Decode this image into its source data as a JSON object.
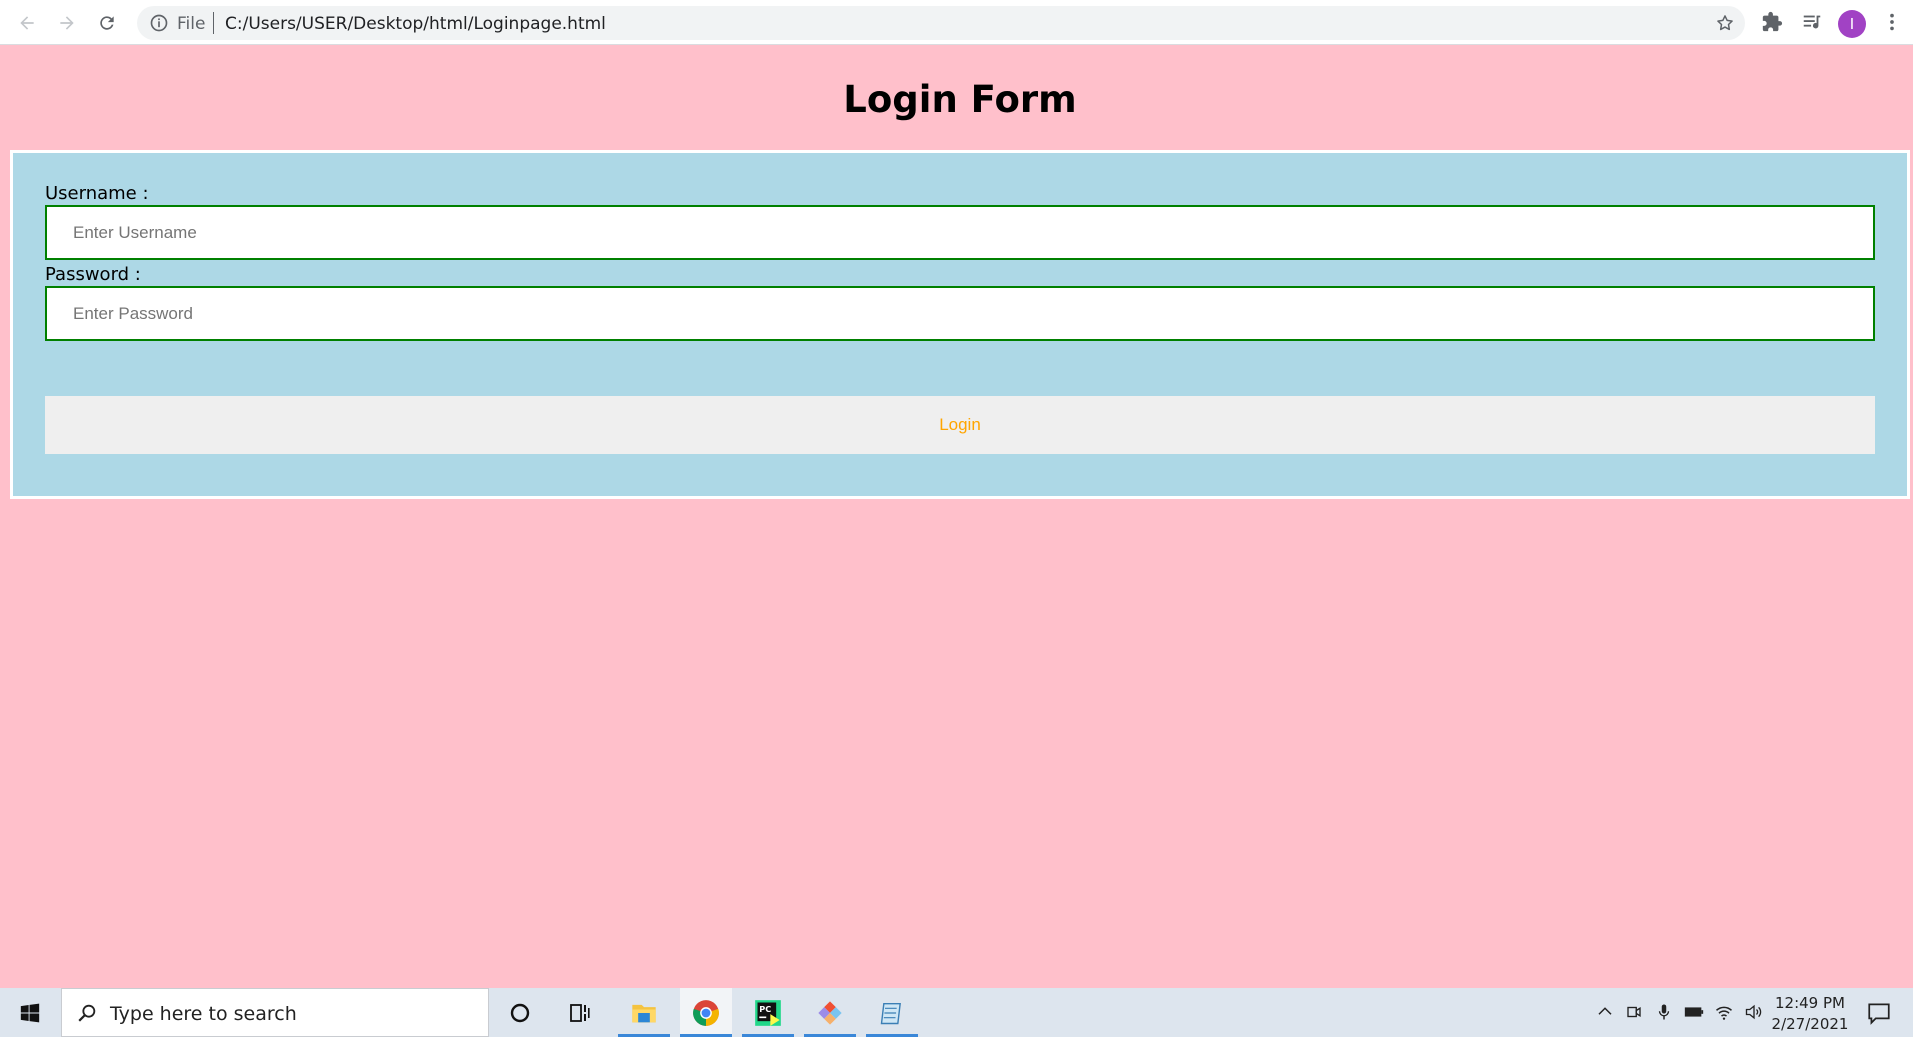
{
  "browser": {
    "url_scheme": "File",
    "url": "C:/Users/USER/Desktop/html/Loginpage.html",
    "profile_initial": "I",
    "profile_color": "#a142c4"
  },
  "page": {
    "title": "Login Form",
    "background": "#ffc0cb",
    "form_background": "#add8e6",
    "username_label": "Username :",
    "username_placeholder": "Enter Username",
    "password_label": "Password :",
    "password_placeholder": "Enter Password",
    "login_button": "Login",
    "login_text_color": "#ffa500",
    "input_border_color": "#008000"
  },
  "taskbar": {
    "search_placeholder": "Type here to search",
    "apps": [
      "cortana-icon",
      "task-view-icon",
      "file-explorer-icon",
      "chrome-icon",
      "pycharm-icon",
      "git-icon",
      "notepad-icon"
    ],
    "time": "12:49 PM",
    "date": "2/27/2021"
  }
}
